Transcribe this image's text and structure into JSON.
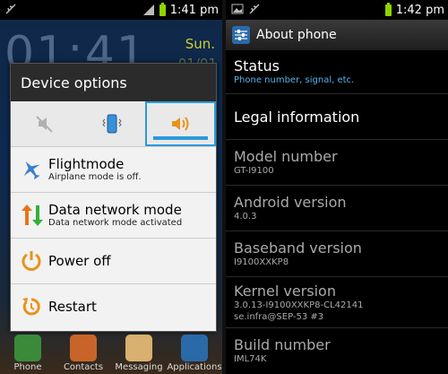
{
  "left": {
    "status_time": "1:41 pm",
    "clock_big": "01:41",
    "clock_day": "Sun.",
    "clock_date": "01/01",
    "dialog": {
      "title": "Device options",
      "modes": [
        {
          "name": "mute-icon",
          "selected": false
        },
        {
          "name": "vibrate-icon",
          "selected": false
        },
        {
          "name": "sound-icon",
          "selected": true
        }
      ],
      "options": [
        {
          "title": "Flightmode",
          "subtitle": "Airplane mode is off."
        },
        {
          "title": "Data network mode",
          "subtitle": "Data network mode activated"
        },
        {
          "title": "Power off",
          "subtitle": ""
        },
        {
          "title": "Restart",
          "subtitle": ""
        }
      ]
    },
    "dock": [
      "Phone",
      "Contacts",
      "Messaging",
      "Applications"
    ]
  },
  "right": {
    "status_time": "1:42 pm",
    "title": "About phone",
    "items": [
      {
        "title": "Status",
        "subtitle": "Phone number, signal, etc."
      },
      {
        "title": "Legal information",
        "subtitle": ""
      },
      {
        "title": "Model number",
        "subtitle": "GT-I9100"
      },
      {
        "title": "Android version",
        "subtitle": "4.0.3"
      },
      {
        "title": "Baseband version",
        "subtitle": "I9100XXKP8"
      },
      {
        "title": "Kernel version",
        "subtitle": "3.0.13-I9100XXKP8-CL42141",
        "subtitle2": "se.infra@SEP-53 #3"
      },
      {
        "title": "Build number",
        "subtitle": "IML74K"
      }
    ]
  },
  "colors": {
    "accent": "#2a9ad8",
    "link": "#56b4e9",
    "battery": "#8fd400"
  }
}
